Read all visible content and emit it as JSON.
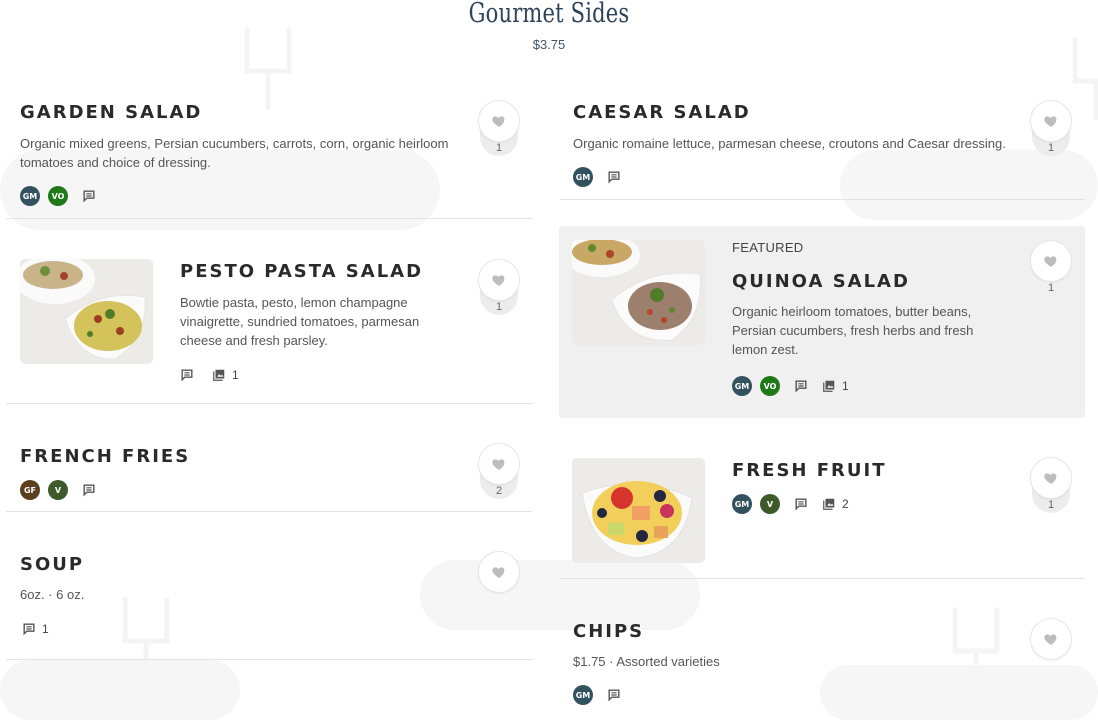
{
  "section": {
    "title": "Gourmet Sides",
    "price": "$3.75"
  },
  "colors": {
    "gm": "#33525f",
    "vo": "#1d7a16",
    "v": "#3c5a2b",
    "gf": "#5a3e1e",
    "heart": "#bdbdbd",
    "icon": "#555555"
  },
  "items": {
    "garden_salad": {
      "name": "GARDEN SALAD",
      "description": "Organic mixed greens, Persian cucumbers, carrots, corn, organic heirloom tomatoes and choice of dressing.",
      "badges": [
        "GM",
        "VO"
      ],
      "likes": "1"
    },
    "caesar_salad": {
      "name": "CAESAR SALAD",
      "description": "Organic romaine lettuce, parmesan cheese, croutons and Caesar dressing.",
      "badges": [
        "GM"
      ],
      "likes": "1"
    },
    "pesto_pasta_salad": {
      "name": "PESTO PASTA SALAD",
      "description": "Bowtie pasta, pesto, lemon champagne vinaigrette, sundried tomatoes, parmesan cheese and fresh parsley.",
      "photo_count": "1",
      "likes": "1"
    },
    "quinoa_salad": {
      "featured_label": "FEATURED",
      "name": "QUINOA SALAD",
      "description": "Organic heirloom tomatoes, butter beans, Persian cucumbers, fresh herbs and fresh lemon zest.",
      "badges": [
        "GM",
        "VO"
      ],
      "photo_count": "1",
      "likes": "1"
    },
    "french_fries": {
      "name": "FRENCH FRIES",
      "badges": [
        "GF",
        "V"
      ],
      "likes": "2"
    },
    "fresh_fruit": {
      "name": "FRESH FRUIT",
      "badges": [
        "GM",
        "V"
      ],
      "photo_count": "2",
      "likes": "1"
    },
    "soup": {
      "name": "SOUP",
      "description": "6oz. · 6 oz.",
      "comment_count": "1"
    },
    "chips": {
      "name": "CHIPS",
      "description": "$1.75 · Assorted varieties",
      "badges": [
        "GM"
      ]
    }
  }
}
